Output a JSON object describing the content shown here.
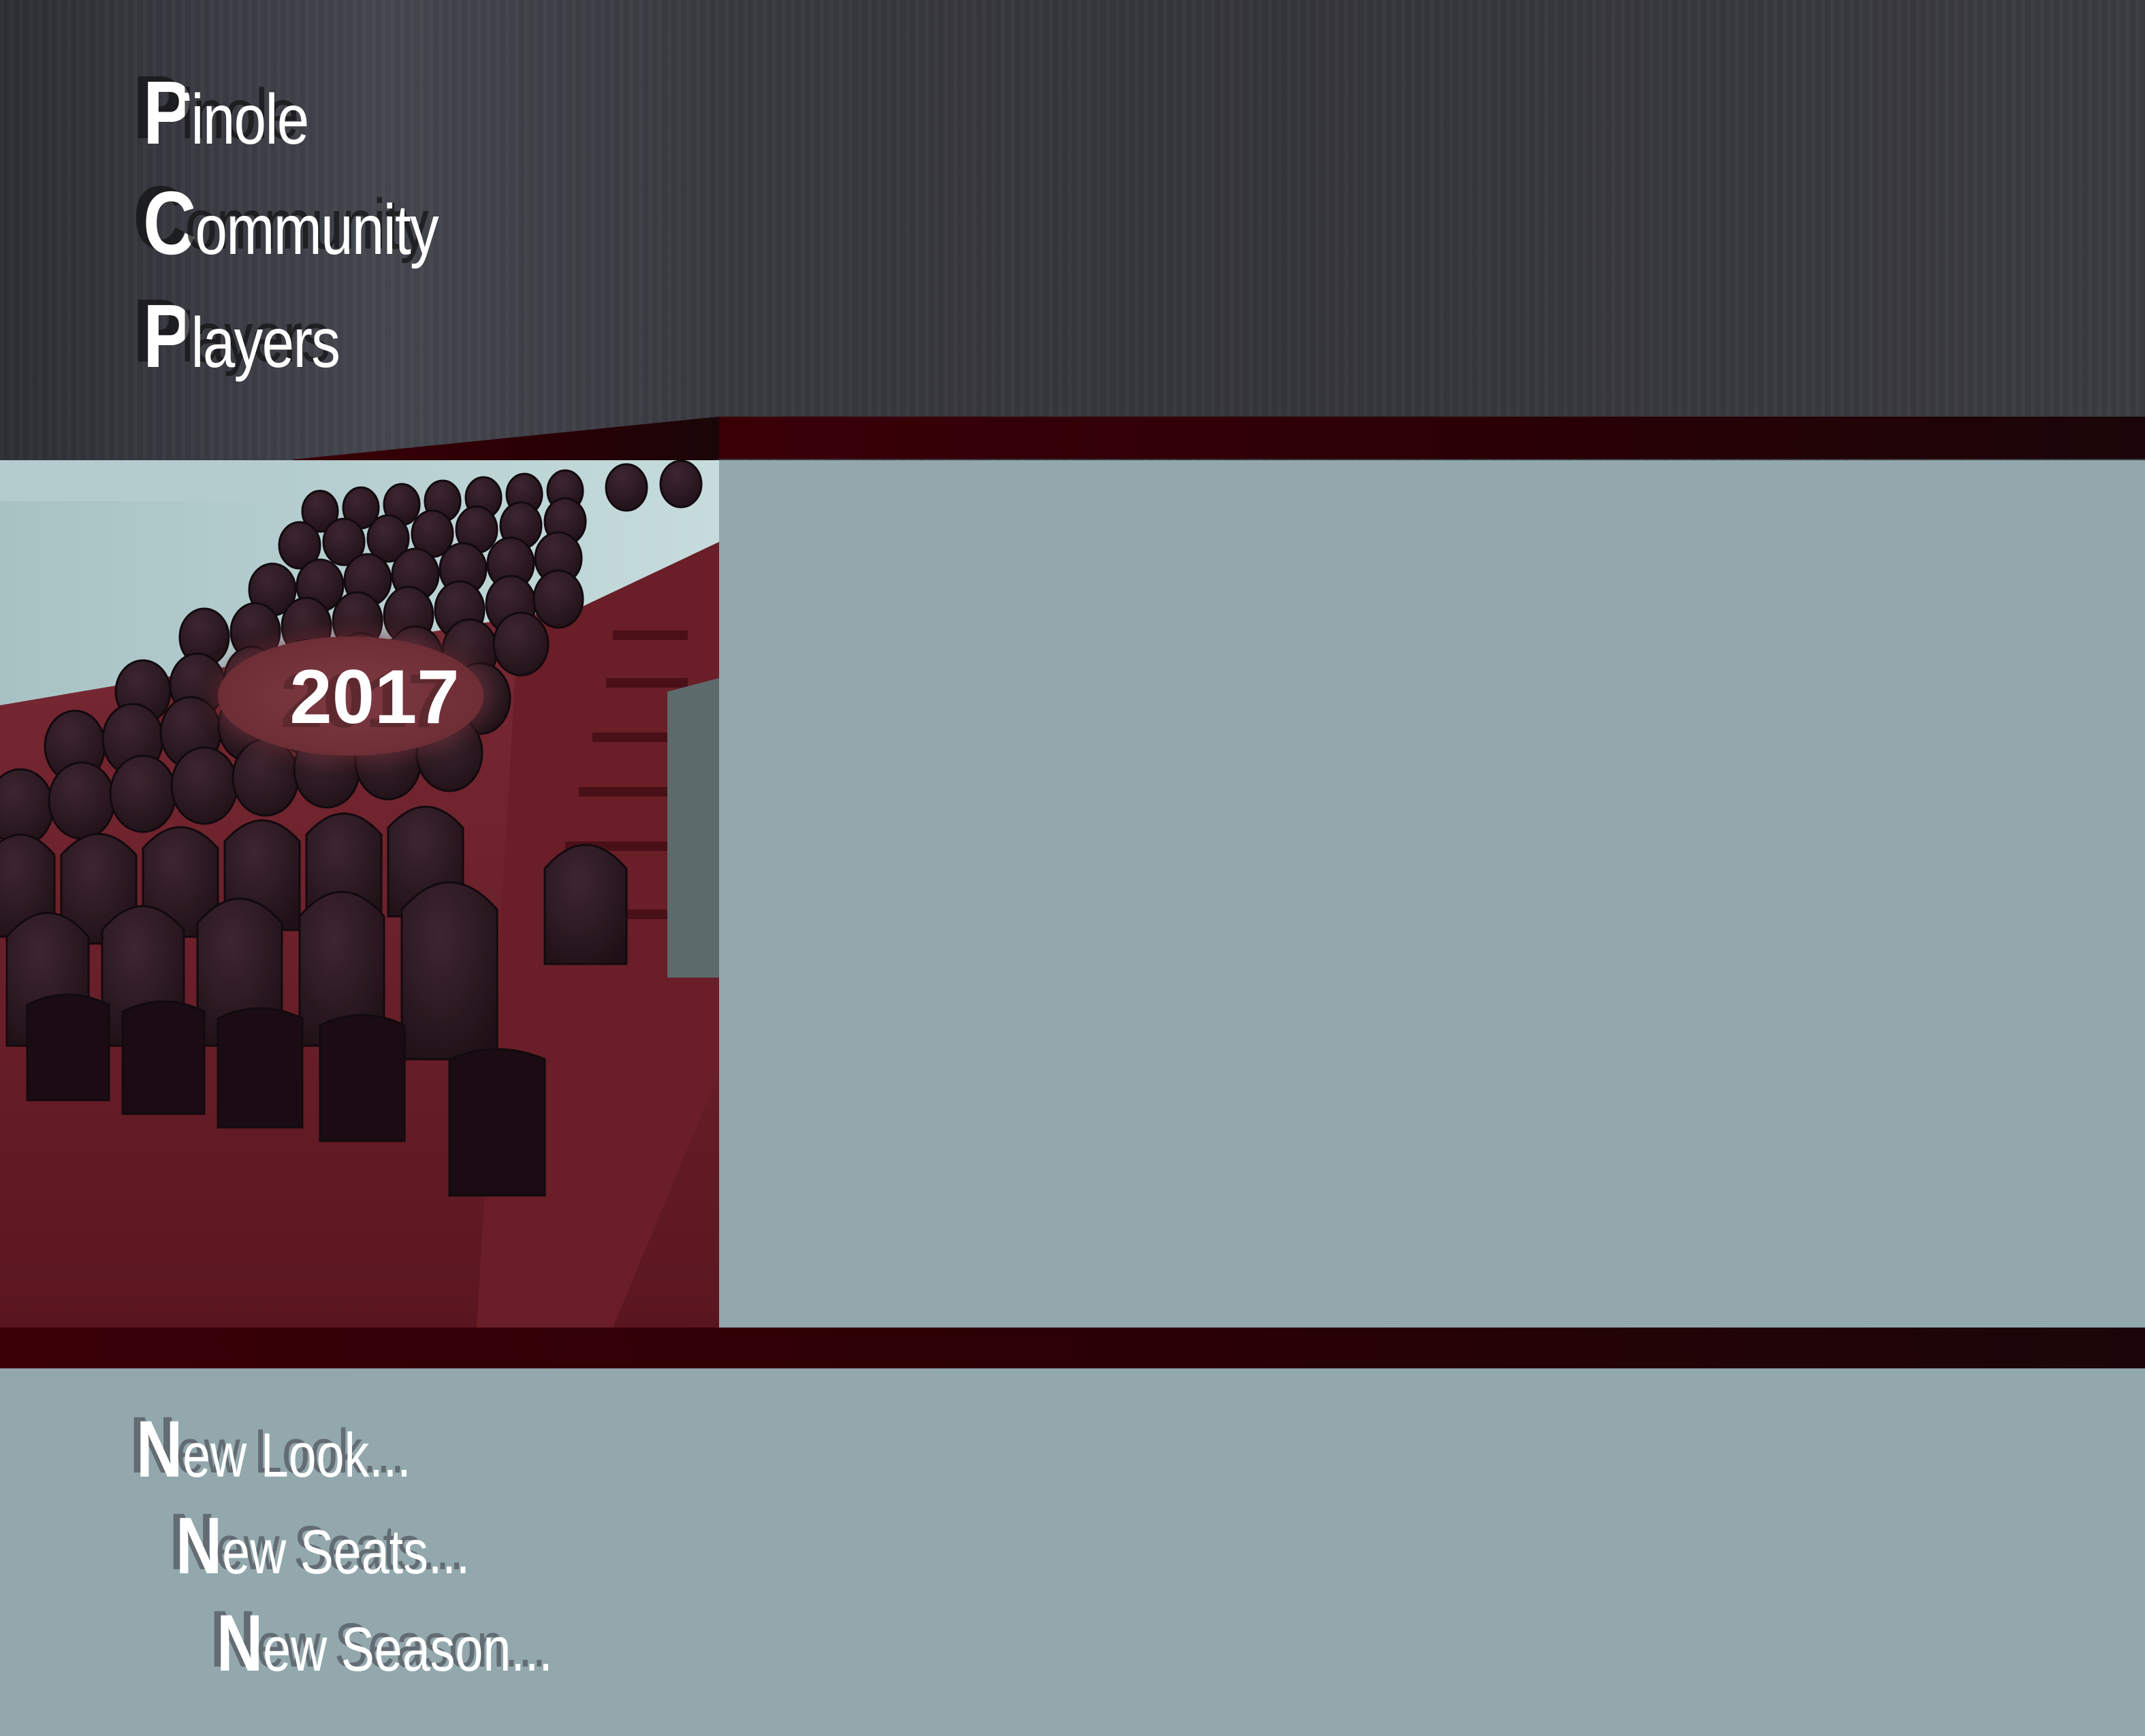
{
  "title": {
    "line1": {
      "initial": "P",
      "rest": "inole"
    },
    "line2": {
      "initial": "C",
      "rest": "ommunity"
    },
    "line3": {
      "initial": "P",
      "rest": "layers"
    }
  },
  "year": "2017",
  "tagline": [
    {
      "initial": "N",
      "rest": "ew Look..."
    },
    {
      "initial": "N",
      "rest": "ew Seats..."
    },
    {
      "initial": "N",
      "rest": "ew Season..."
    }
  ],
  "colors": {
    "dark_band": "#393a40",
    "maroon": "#2a0005",
    "panel_grey": "#92a8ac",
    "seat": "#2d1a22",
    "carpet": "#6a1e28"
  }
}
